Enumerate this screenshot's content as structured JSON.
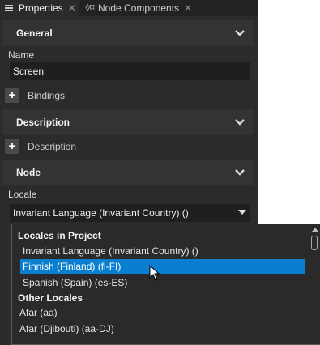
{
  "tabs": [
    {
      "label": "Properties",
      "icon": "list-icon"
    },
    {
      "label": "Node Components",
      "icon": "components-icon"
    }
  ],
  "sections": {
    "general": {
      "title": "General"
    },
    "description": {
      "title": "Description"
    },
    "node": {
      "title": "Node"
    }
  },
  "general": {
    "name_label": "Name",
    "name_value": "Screen",
    "bindings_label": "Bindings"
  },
  "description": {
    "add_label": "Description"
  },
  "node": {
    "locale_label": "Locale",
    "locale_value": "Invariant Language (Invariant Country) ()"
  },
  "dropdown": {
    "group_project": "Locales in Project",
    "project_items": [
      "Invariant Language (Invariant Country) ()",
      "Finnish (Finland) (fi-FI)",
      "Spanish (Spain) (es-ES)"
    ],
    "selected_index": 1,
    "group_other": "Other Locales",
    "other_items": [
      "Afar (aa)",
      "Afar (Djibouti) (aa-DJ)"
    ]
  },
  "colors": {
    "accent": "#0a7ecf",
    "panel_bg": "#2b2b2b",
    "header_bg": "#333333",
    "input_bg": "#1f1f1f"
  }
}
